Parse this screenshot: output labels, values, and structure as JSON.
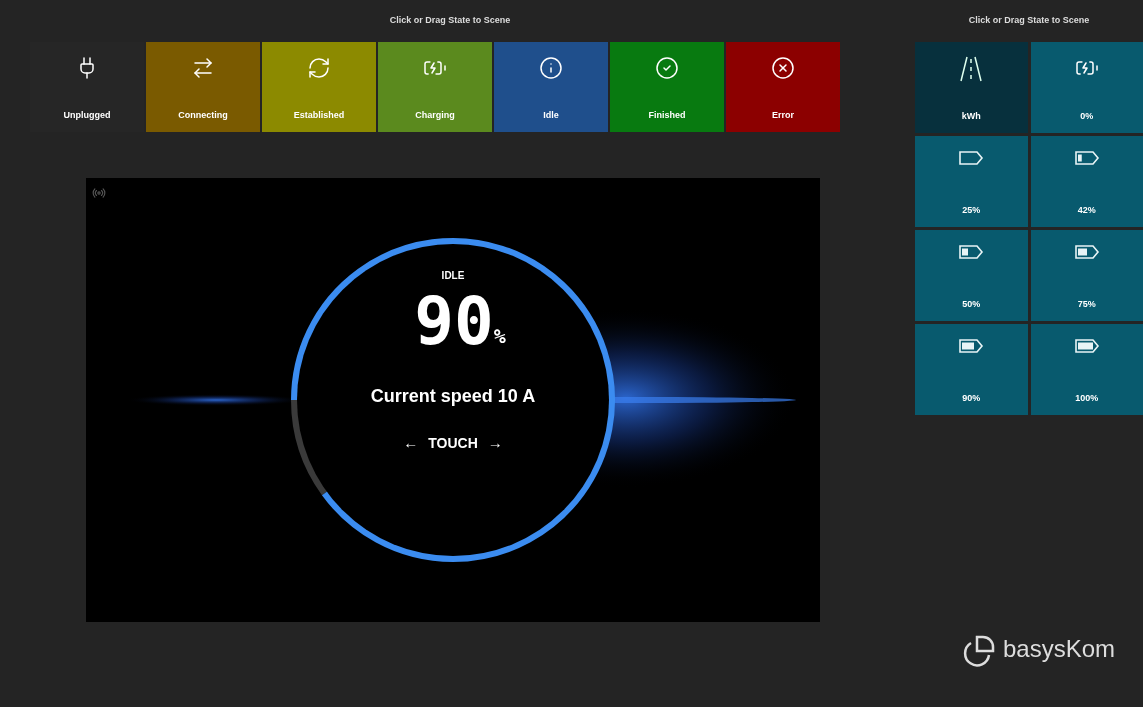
{
  "states_panel": {
    "heading": "Click or Drag State to Scene",
    "states": [
      {
        "kind": "unplugged",
        "label": "Unplugged",
        "color": "#262626",
        "selected": false
      },
      {
        "kind": "connecting",
        "label": "Connecting",
        "color": "#7a5a00",
        "selected": false
      },
      {
        "kind": "established",
        "label": "Established",
        "color": "#8c8a00",
        "selected": false
      },
      {
        "kind": "charging",
        "label": "Charging",
        "color": "#5b8a1e",
        "selected": false
      },
      {
        "kind": "idle",
        "label": "Idle",
        "color": "#1f4f8c",
        "selected": false
      },
      {
        "kind": "finished",
        "label": "Finished",
        "color": "#087a10",
        "selected": false
      },
      {
        "kind": "error",
        "label": "Error",
        "color": "#8c0000",
        "selected": false
      }
    ]
  },
  "scene": {
    "status": "IDLE",
    "percent": "90",
    "unit": "%",
    "speed": "Current speed 10 A",
    "arrow_left": "←",
    "touch": "TOUCH",
    "arrow_right": "→"
  },
  "levels_panel": {
    "heading": "Click or Drag State to Scene",
    "tiles": [
      {
        "kind": "road",
        "label": "kWh",
        "selected": true
      },
      {
        "kind": "charging",
        "label": "0%",
        "selected": false
      },
      {
        "kind": "battery",
        "label": "25%",
        "selected": false
      },
      {
        "kind": "battery",
        "label": "42%",
        "selected": false
      },
      {
        "kind": "battery",
        "label": "50%",
        "selected": false
      },
      {
        "kind": "battery",
        "label": "75%",
        "selected": false
      },
      {
        "kind": "battery",
        "label": "90%",
        "selected": false
      },
      {
        "kind": "battery",
        "label": "100%",
        "selected": false
      }
    ]
  },
  "logo": {
    "text": "basysKom"
  }
}
